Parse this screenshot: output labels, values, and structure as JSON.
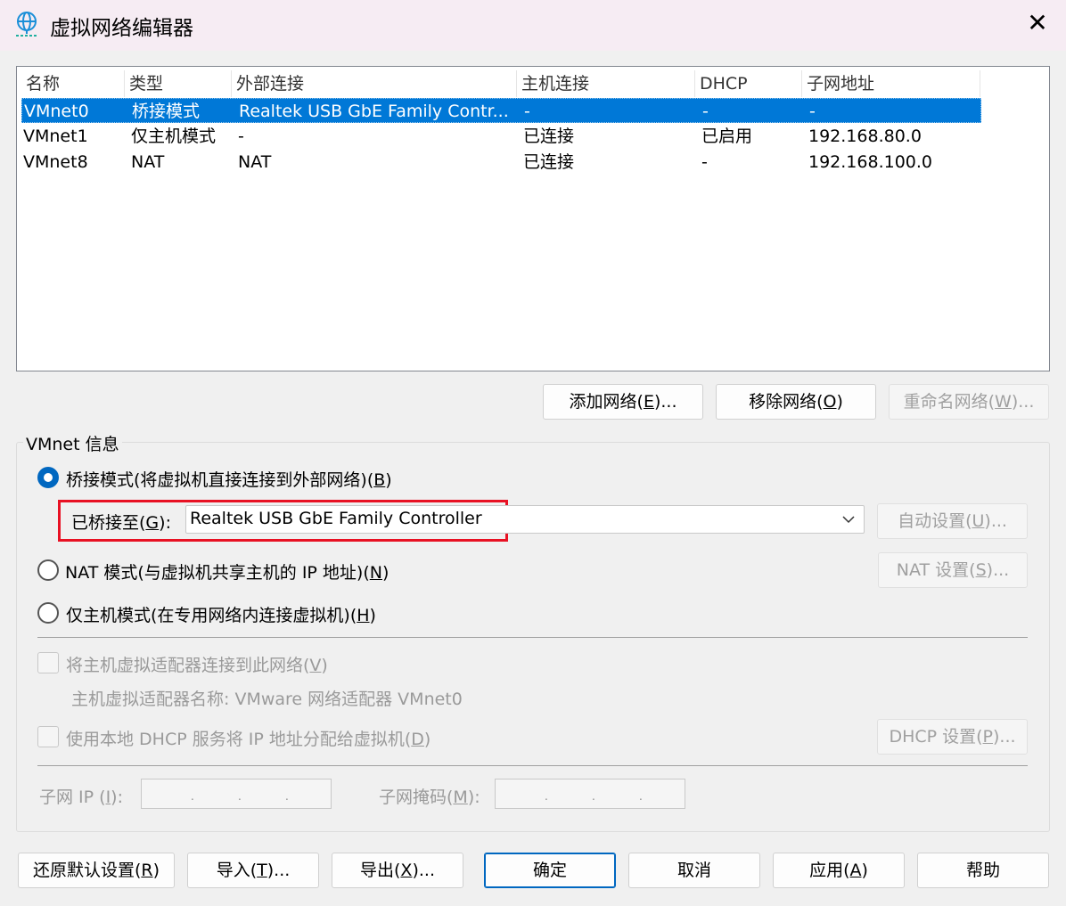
{
  "window": {
    "title": "虚拟网络编辑器",
    "icon": "globe-network-icon",
    "close": "✕"
  },
  "table": {
    "headers": [
      "名称",
      "类型",
      "外部连接",
      "主机连接",
      "DHCP",
      "子网地址"
    ],
    "rows": [
      [
        "VMnet0",
        "桥接模式",
        "Realtek USB GbE Family Contr...",
        "-",
        "-",
        "-"
      ],
      [
        "VMnet1",
        "仅主机模式",
        "-",
        "已连接",
        "已启用",
        "192.168.80.0"
      ],
      [
        "VMnet8",
        "NAT",
        "NAT",
        "已连接",
        "-",
        "192.168.100.0"
      ]
    ],
    "selected_index": 0
  },
  "net_buttons": {
    "add": {
      "pre": "添加网络(",
      "key": "E",
      "post": ")..."
    },
    "remove": {
      "pre": "移除网络(",
      "key": "O",
      "post": ")"
    },
    "rename": {
      "pre": "重命名网络(",
      "key": "W",
      "post": ")..."
    }
  },
  "info": {
    "legend": "VMnet 信息",
    "bridged": {
      "pre": "桥接模式(将虚拟机直接连接到外部网络)(",
      "key": "B",
      "post": ")",
      "selected": true
    },
    "bridged_to": {
      "pre": "已桥接至(",
      "key": "G",
      "post": "):",
      "value": "Realtek USB GbE Family Controller"
    },
    "auto": {
      "pre": "自动设置(",
      "key": "U",
      "post": ")..."
    },
    "nat": {
      "pre": "NAT 模式(与虚拟机共享主机的 IP 地址)(",
      "key": "N",
      "post": ")"
    },
    "nat_settings": {
      "pre": "NAT 设置(",
      "key": "S",
      "post": ")..."
    },
    "hostonly": {
      "pre": "仅主机模式(在专用网络内连接虚拟机)(",
      "key": "H",
      "post": ")"
    },
    "connect_adapter": {
      "pre": "将主机虚拟适配器连接到此网络(",
      "key": "V",
      "post": ")"
    },
    "adapter_name": "主机虚拟适配器名称: VMware 网络适配器 VMnet0",
    "dhcp": {
      "pre": "使用本地 DHCP 服务将 IP 地址分配给虚拟机(",
      "key": "D",
      "post": ")"
    },
    "dhcp_settings": {
      "pre": "DHCP 设置(",
      "key": "P",
      "post": ")..."
    },
    "subnet_ip": {
      "pre": "子网 IP (",
      "key": "I",
      "post": "):"
    },
    "subnet_mask": {
      "pre": "子网掩码(",
      "key": "M",
      "post": "):"
    }
  },
  "footer": {
    "restore": {
      "pre": "还原默认设置(",
      "key": "R",
      "post": ")"
    },
    "import": {
      "pre": "导入(",
      "key": "T",
      "post": ")..."
    },
    "export": {
      "pre": "导出(",
      "key": "X",
      "post": ")..."
    },
    "ok": "确定",
    "cancel": "取消",
    "apply": {
      "pre": "应用(",
      "key": "A",
      "post": ")"
    },
    "help": "帮助"
  },
  "colors": {
    "selection": "#0078d7",
    "highlight": "#e81123",
    "accent": "#0067c0"
  }
}
